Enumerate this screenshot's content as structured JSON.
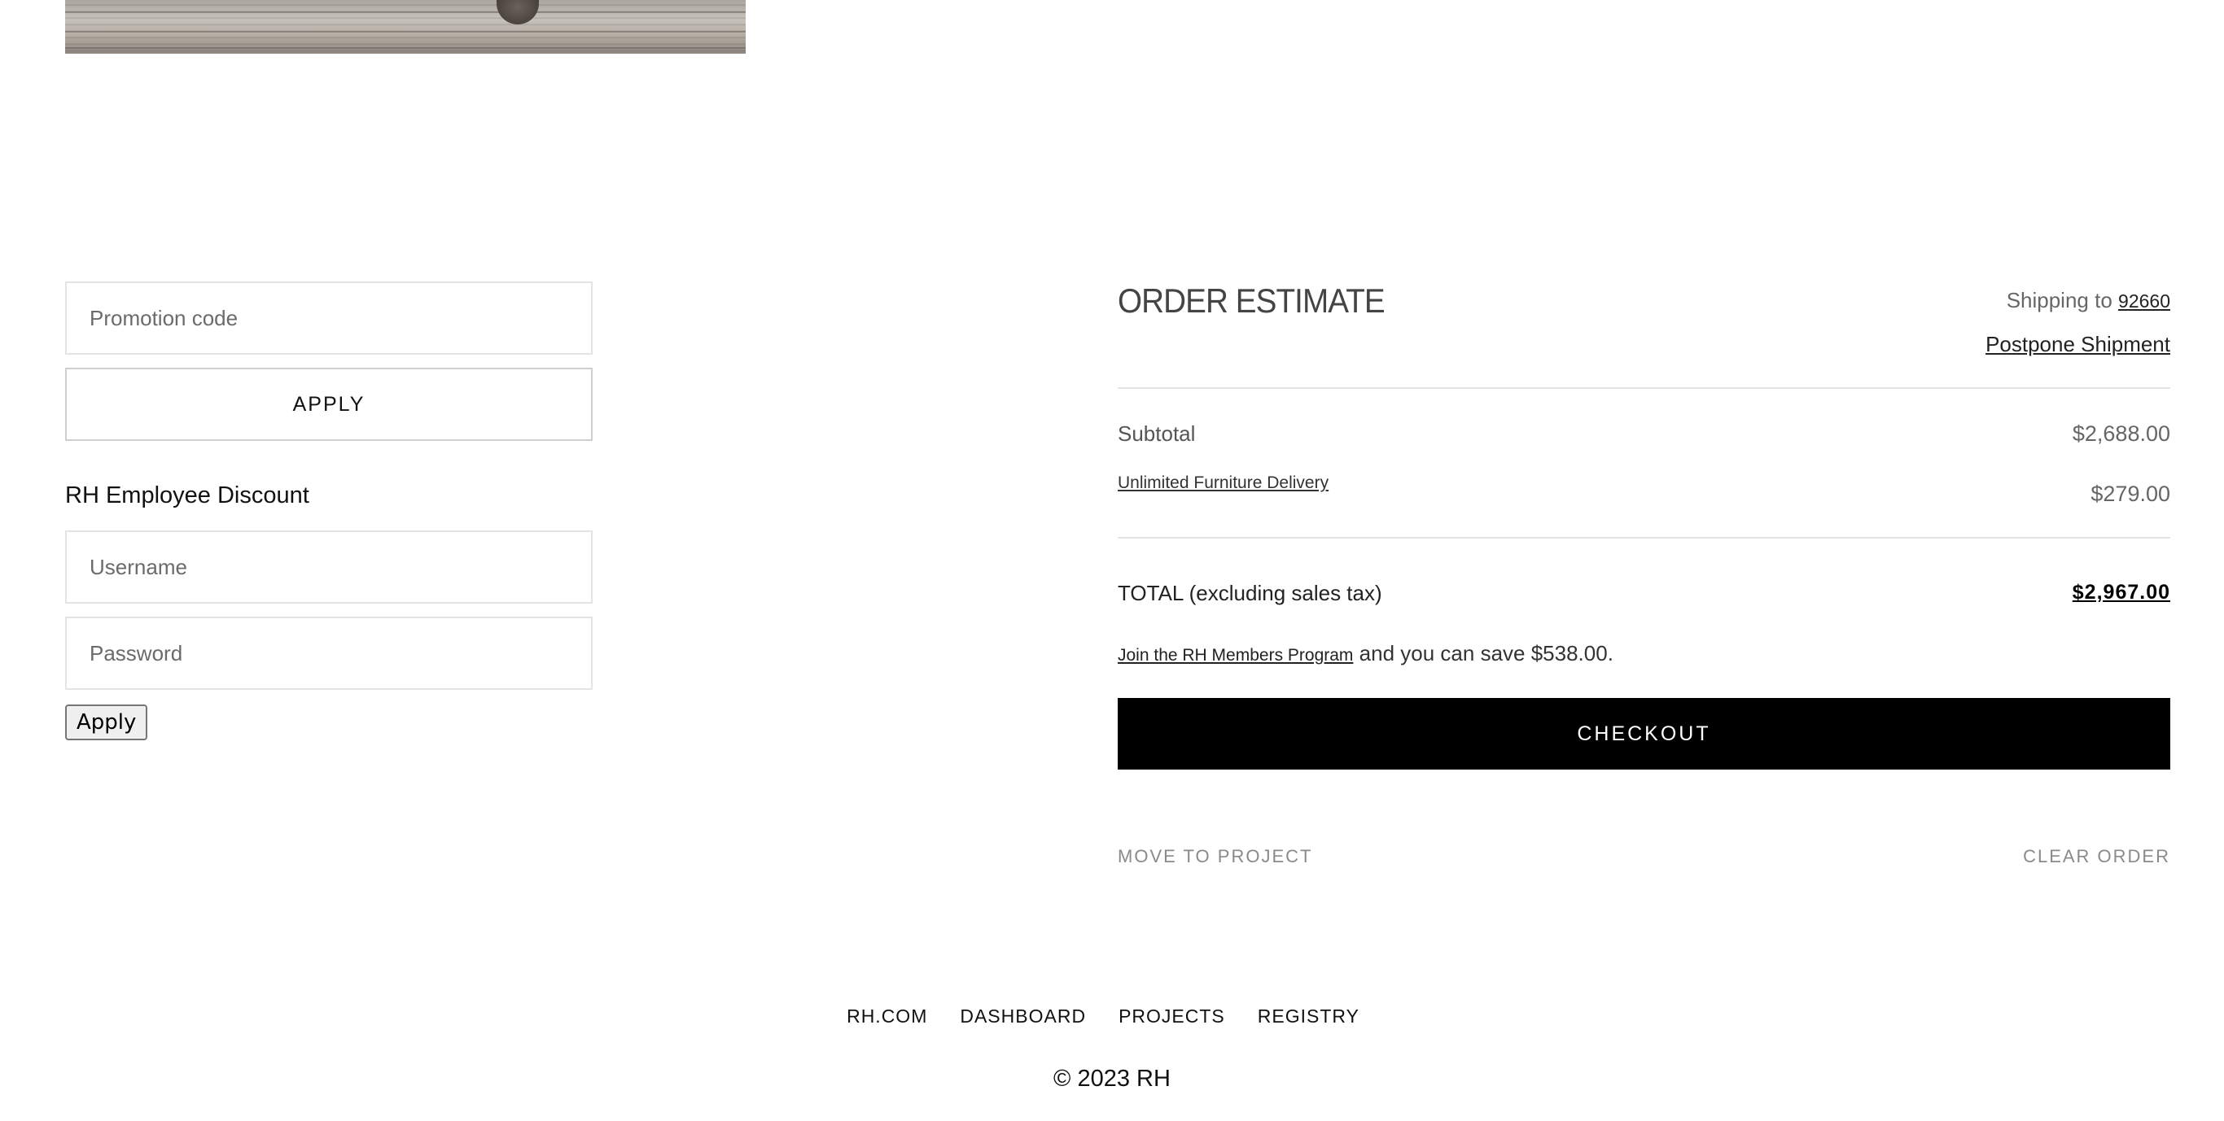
{
  "promo": {
    "placeholder": "Promotion code",
    "apply_label": "APPLY"
  },
  "employee_discount": {
    "heading": "RH Employee Discount",
    "username_placeholder": "Username",
    "password_placeholder": "Password",
    "apply_label": "Apply"
  },
  "order": {
    "title": "ORDER ESTIMATE",
    "shipping_prefix": "Shipping to",
    "zip": "92660",
    "postpone_label": "Postpone Shipment",
    "subtotal_label": "Subtotal",
    "subtotal_value": "$2,688.00",
    "delivery_label": "Unlimited Furniture Delivery",
    "delivery_value": "$279.00",
    "total_label": "TOTAL (excluding sales tax)",
    "total_value": "$2,967.00",
    "members_link": "Join the RH Members Program",
    "members_text": "and you can save $538.00.",
    "checkout_label": "CHECKOUT",
    "move_to_project_label": "MOVE TO PROJECT",
    "clear_order_label": "CLEAR ORDER"
  },
  "footer": {
    "links": [
      "RH.COM",
      "DASHBOARD",
      "PROJECTS",
      "REGISTRY"
    ],
    "copyright": "© 2023 RH"
  }
}
